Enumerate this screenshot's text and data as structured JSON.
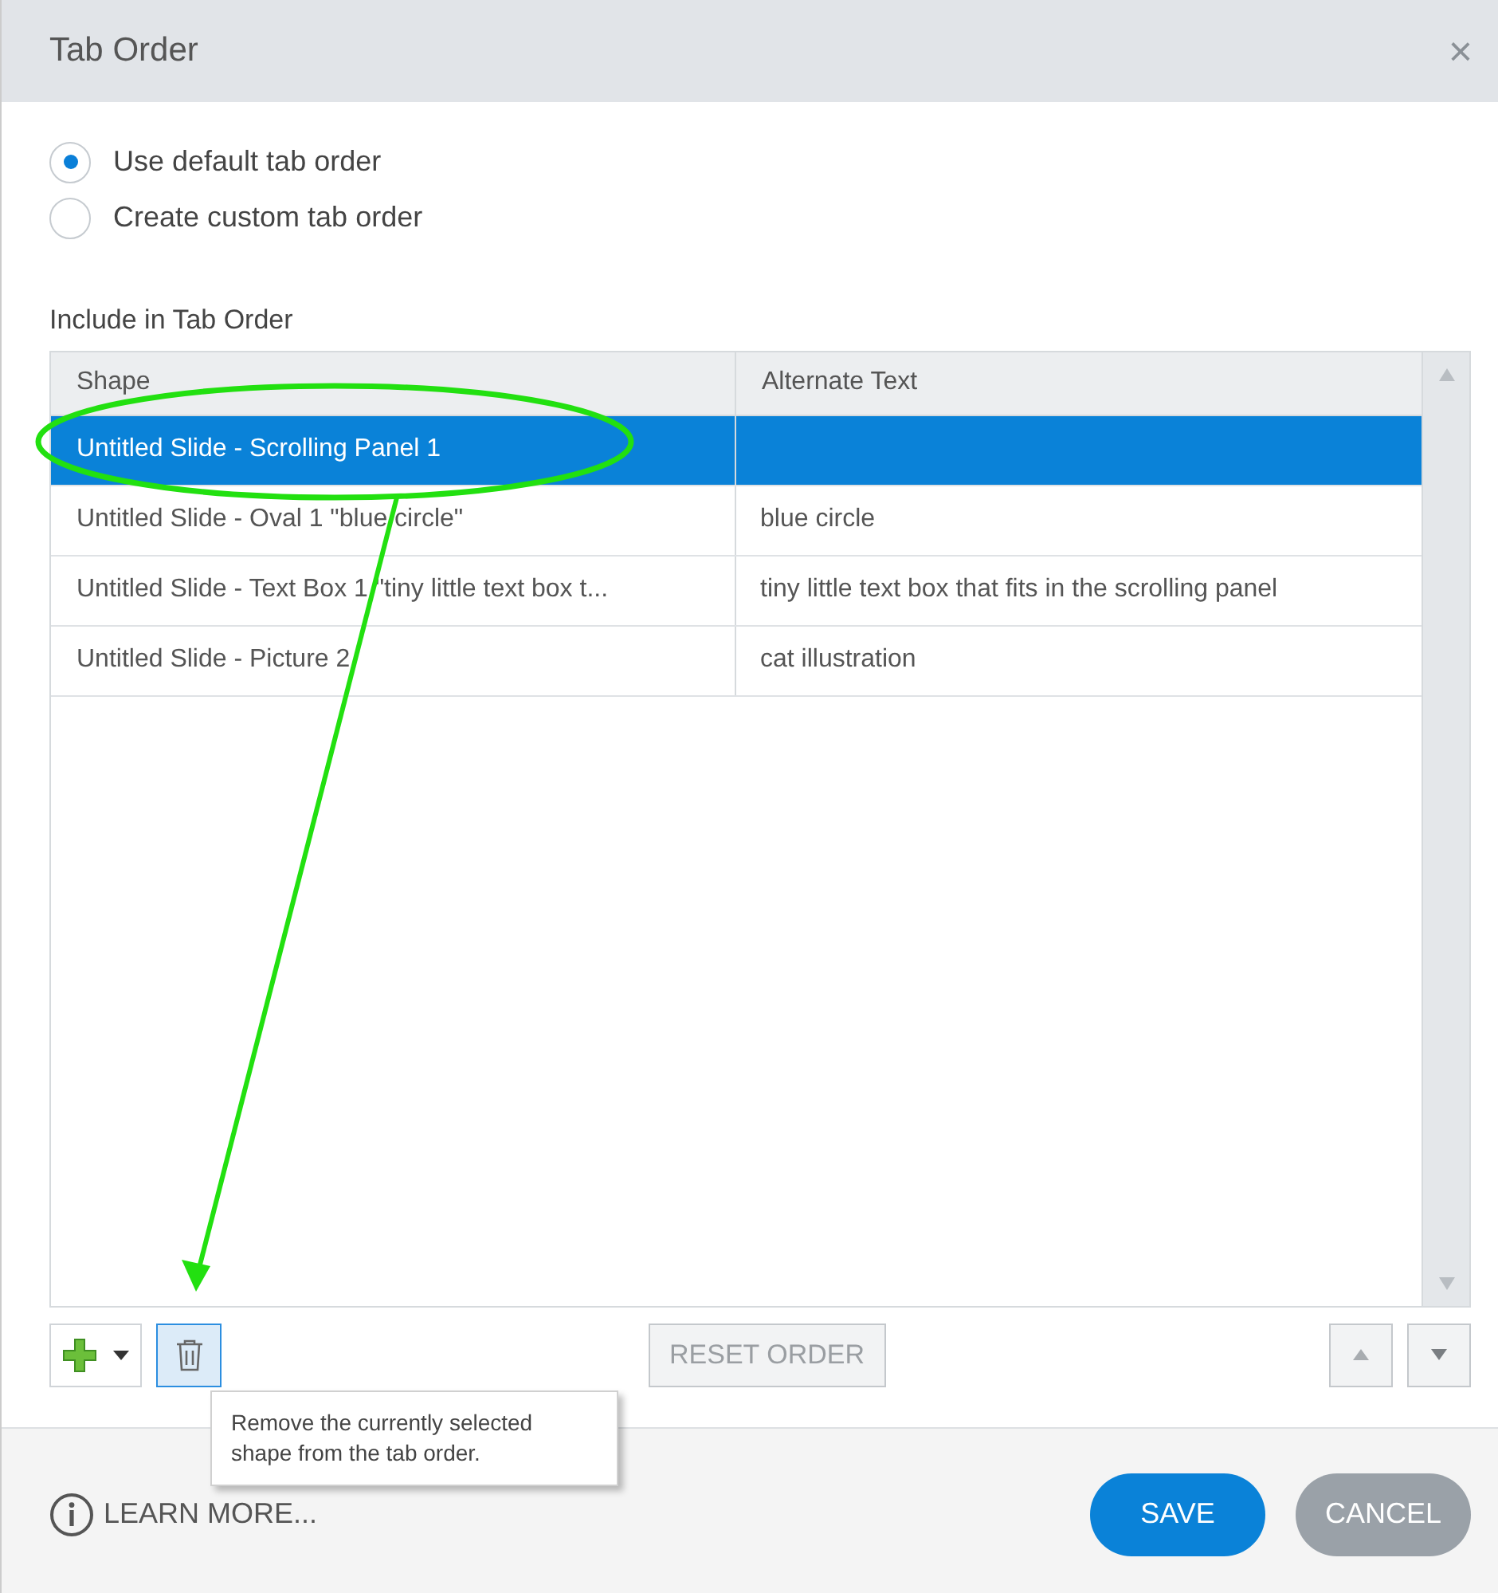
{
  "window": {
    "title": "Tab Order",
    "close": "×"
  },
  "options": [
    {
      "label": "Use default tab order",
      "selected": true
    },
    {
      "label": "Create custom tab order",
      "selected": false
    }
  ],
  "table": {
    "title": "Include in Tab Order",
    "columns": [
      "Shape",
      "Alternate Text"
    ],
    "rows": [
      {
        "shape": "Untitled Slide - Scrolling Panel 1",
        "alt": "",
        "selected": true
      },
      {
        "shape": "Untitled Slide - Oval 1 \"blue circle\"",
        "alt": "blue circle",
        "selected": false
      },
      {
        "shape": "Untitled Slide - Text Box 1 \"tiny little text box t...",
        "alt": "tiny little text box that fits in the scrolling panel",
        "selected": false
      },
      {
        "shape": "Untitled Slide - Picture 2",
        "alt": "cat illustration",
        "selected": false
      }
    ]
  },
  "toolbar": {
    "reset": "RESET ORDER",
    "tooltip": "Remove the currently selected shape from the tab order."
  },
  "footer": {
    "learn_more": "LEARN MORE...",
    "save": "SAVE",
    "cancel": "CANCEL"
  }
}
